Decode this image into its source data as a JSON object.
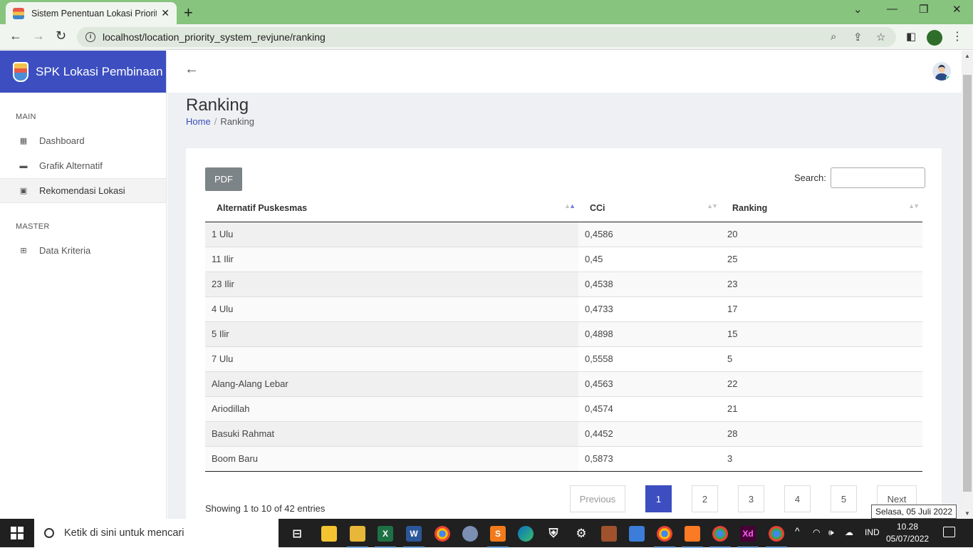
{
  "browser": {
    "tab_title": "Sistem Penentuan Lokasi Prioritas",
    "url": "localhost/location_priority_system_revjune/ranking"
  },
  "app": {
    "brand": "SPK Lokasi Pembinaan"
  },
  "sidebar": {
    "sections": [
      {
        "title": "MAIN",
        "items": [
          {
            "label": "Dashboard",
            "icon": "dashboard-icon"
          },
          {
            "label": "Grafik Alternatif",
            "icon": "chart-icon"
          },
          {
            "label": "Rekomendasi Lokasi",
            "icon": "location-icon",
            "active": true
          }
        ]
      },
      {
        "title": "MASTER",
        "items": [
          {
            "label": "Data Kriteria",
            "icon": "table-icon"
          }
        ]
      }
    ]
  },
  "page": {
    "title": "Ranking",
    "breadcrumb": {
      "home": "Home",
      "current": "Ranking"
    }
  },
  "toolbar": {
    "pdf_label": "PDF",
    "search_label": "Search:",
    "search_value": ""
  },
  "table": {
    "columns": [
      "Alternatif Puskesmas",
      "CCi",
      "Ranking"
    ],
    "rows": [
      [
        "1 Ulu",
        "0,4586",
        "20"
      ],
      [
        "11 Ilir",
        "0,45",
        "25"
      ],
      [
        "23 Ilir",
        "0,4538",
        "23"
      ],
      [
        "4 Ulu",
        "0,4733",
        "17"
      ],
      [
        "5 Ilir",
        "0,4898",
        "15"
      ],
      [
        "7 Ulu",
        "0,5558",
        "5"
      ],
      [
        "Alang-Alang Lebar",
        "0,4563",
        "22"
      ],
      [
        "Ariodillah",
        "0,4574",
        "21"
      ],
      [
        "Basuki Rahmat",
        "0,4452",
        "28"
      ],
      [
        "Boom Baru",
        "0,5873",
        "3"
      ]
    ]
  },
  "pagination": {
    "info": "Showing 1 to 10 of 42 entries",
    "previous": "Previous",
    "next": "Next",
    "pages": [
      "1",
      "2",
      "3",
      "4",
      "5"
    ],
    "current": "1"
  },
  "tooltip": "Selasa, 05 Juli 2022",
  "taskbar": {
    "search_placeholder": "Ketik di sini untuk mencari",
    "language": "IND",
    "time": "10.28",
    "date": "05/07/2022"
  },
  "colors": {
    "primary": "#3c4ec0",
    "browser_frame": "#87c47e",
    "pdf_button": "#7d8487"
  }
}
